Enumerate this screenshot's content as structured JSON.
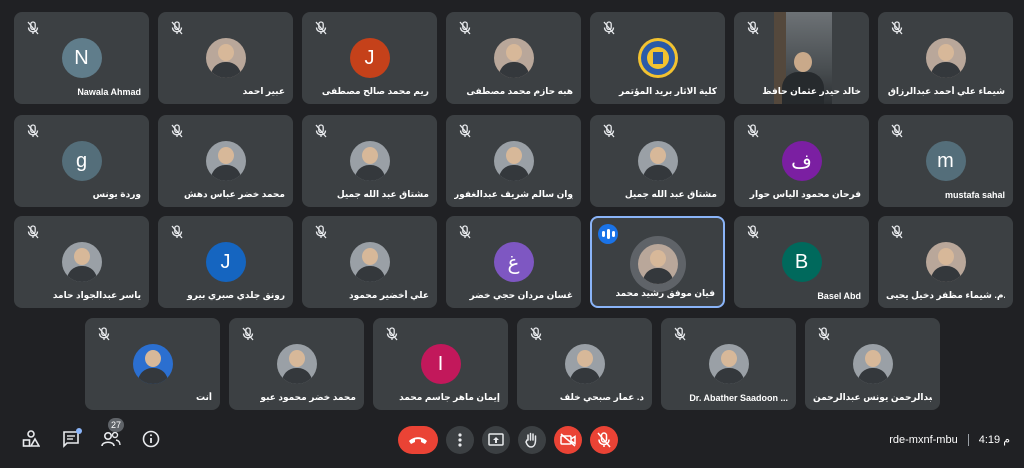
{
  "participants_count": "27",
  "meeting": {
    "code": "rde-mxnf-mbu",
    "time": "4:19 م"
  },
  "tiles": [
    {
      "name": "شيماء علي أحمد عبدالرزاق",
      "kind": "photo-hijab"
    },
    {
      "name": "خالد حيدر عثمان حافظ",
      "kind": "video"
    },
    {
      "name": "كلية الاثار بريد المؤتمر",
      "kind": "logo"
    },
    {
      "name": "هبه حازم محمد مصطفى",
      "kind": "photo-hijab"
    },
    {
      "name": "ريم محمد صالح مصطفى",
      "kind": "letter",
      "letter": "J",
      "color": "#c5411a"
    },
    {
      "name": "عبير احمد",
      "kind": "photo-hijab"
    },
    {
      "name": "Nawala Ahmad",
      "kind": "letter",
      "letter": "N",
      "color": "#607d8b"
    },
    {
      "name": "mustafa sahal",
      "kind": "letter",
      "letter": "m",
      "color": "#546e7a"
    },
    {
      "name": "فرحان محمود الياس حوار",
      "kind": "letter",
      "letter": "ف",
      "color": "#7b1fa2"
    },
    {
      "name": "مشتاق عبد الله جميل",
      "kind": "photo"
    },
    {
      "name": "مروان سالم شريف عبدالغفور",
      "kind": "photo"
    },
    {
      "name": "مشتاق عبد الله جميل",
      "kind": "photo"
    },
    {
      "name": "محمد خضر عباس دهش",
      "kind": "photo"
    },
    {
      "name": "وردة يونس",
      "kind": "letter",
      "letter": "g",
      "color": "#546e7a"
    },
    {
      "name": "م.م. شيماء مظفر دخيل يحيى",
      "kind": "photo-hijab"
    },
    {
      "name": "Basel Abd",
      "kind": "letter",
      "letter": "B",
      "color": "#00695c"
    },
    {
      "name": "فيان موفق رشيد محمد",
      "kind": "photo-hijab",
      "speaking": true
    },
    {
      "name": "غسان مردان حجي خضر",
      "kind": "letter",
      "letter": "غ",
      "color": "#7e57c2"
    },
    {
      "name": "علي أخضير محمود",
      "kind": "photo"
    },
    {
      "name": "رونق جلدي صبري بيرو",
      "kind": "letter",
      "letter": "J",
      "color": "#1565c0"
    },
    {
      "name": "ياسر عبدالجواد حامد",
      "kind": "photo"
    },
    {
      "name": "عبدالرحمن يونس عبدالرحمن",
      "kind": "photo"
    },
    {
      "name": "Dr. Abather Saadoon ...",
      "kind": "photo"
    },
    {
      "name": "د. عمار صبحي خلف",
      "kind": "photo"
    },
    {
      "name": "إيمان ماهر جاسم محمد",
      "kind": "letter",
      "letter": "I",
      "color": "#c2185b"
    },
    {
      "name": "محمد خضر محمود عبو",
      "kind": "photo"
    },
    {
      "name": "أنت",
      "kind": "photo-self"
    }
  ],
  "icons": {
    "mic_off": "mic-off-icon",
    "end_call": "phone-hangup-icon",
    "more": "more-vert-icon",
    "present": "present-screen-icon",
    "hand": "raise-hand-icon",
    "camera_off": "videocam-off-icon",
    "mic_off_btn": "mic-off-icon",
    "activities": "activities-icon",
    "chat": "chat-icon",
    "people": "people-icon",
    "info": "info-icon"
  },
  "colors": {
    "end_call": "#ea4335",
    "tile_bg": "#3c4043",
    "page_bg": "#202124",
    "speaking_border": "#8ab4f8"
  }
}
